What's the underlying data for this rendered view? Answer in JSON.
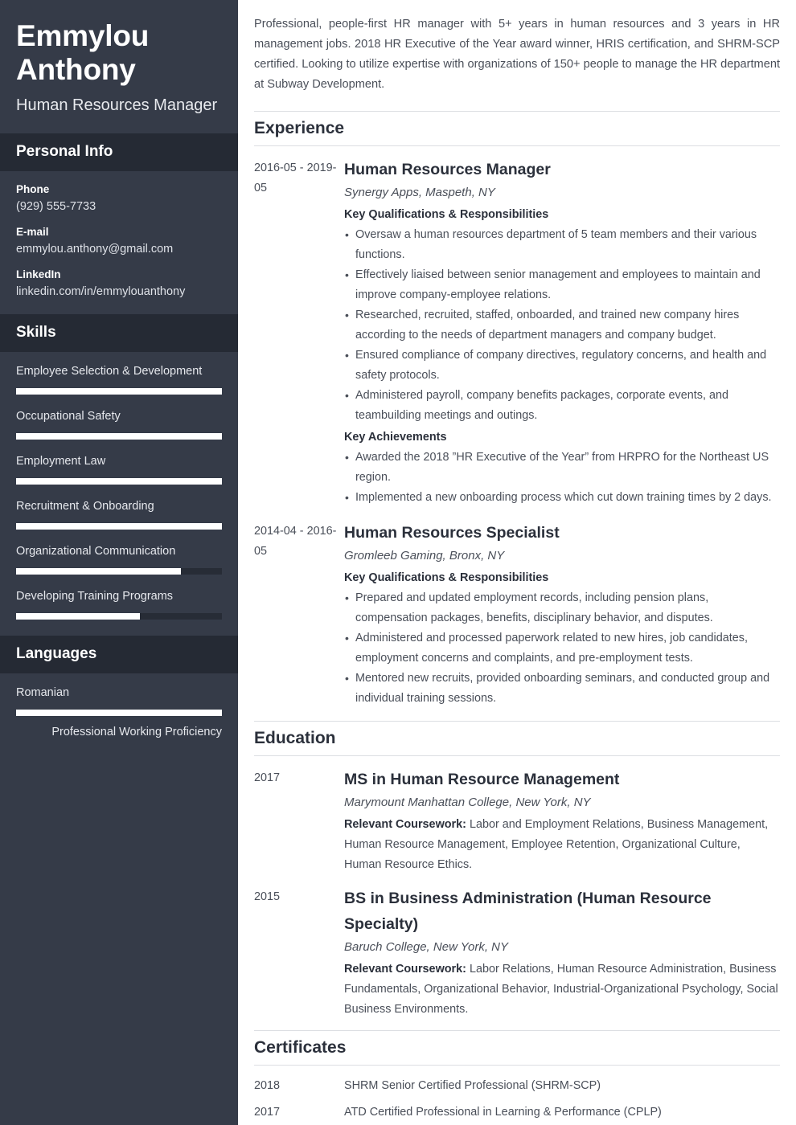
{
  "sidebar": {
    "name": "Emmylou Anthony",
    "job_title": "Human Resources Manager",
    "personal_info": {
      "heading": "Personal Info",
      "items": [
        {
          "label": "Phone",
          "value": "(929) 555-7733"
        },
        {
          "label": "E-mail",
          "value": "emmylou.anthony@gmail.com"
        },
        {
          "label": "LinkedIn",
          "value": "linkedin.com/in/emmylouanthony"
        }
      ]
    },
    "skills": {
      "heading": "Skills",
      "items": [
        {
          "name": "Employee Selection & Development",
          "level": 100
        },
        {
          "name": "Occupational Safety",
          "level": 100
        },
        {
          "name": "Employment Law",
          "level": 100
        },
        {
          "name": "Recruitment & Onboarding",
          "level": 100
        },
        {
          "name": "Organizational Communication",
          "level": 80
        },
        {
          "name": "Developing Training Programs",
          "level": 60
        }
      ]
    },
    "languages": {
      "heading": "Languages",
      "items": [
        {
          "name": "Romanian",
          "level": 100,
          "proficiency": "Professional Working Proficiency"
        }
      ]
    }
  },
  "main": {
    "summary": "Professional, people-first HR manager with 5+ years in human resources and 3 years in HR management jobs. 2018 HR Executive of the Year award winner, HRIS certification, and SHRM-SCP certified. Looking to utilize expertise with organizations of 150+ people to manage the HR department at Subway Development.",
    "experience": {
      "heading": "Experience",
      "entries": [
        {
          "date": "2016-05 - 2019-05",
          "role": "Human Resources Manager",
          "org": "Synergy Apps, Maspeth, NY",
          "qualifications_label": "Key Qualifications & Responsibilities",
          "qualifications": [
            "Oversaw a human resources department of 5 team members and their various functions.",
            "Effectively liaised between senior management and employees to maintain and improve company-employee relations.",
            "Researched, recruited, staffed, onboarded, and trained new company hires according to the needs of department managers and company budget.",
            "Ensured compliance of company directives, regulatory concerns, and health and safety protocols.",
            "Administered payroll, company benefits packages, corporate events, and teambuilding meetings and outings."
          ],
          "achievements_label": "Key Achievements",
          "achievements": [
            "Awarded the 2018 ”HR Executive of the Year” from HRPRO for the Northeast US region.",
            "Implemented a new onboarding process which cut down training times by 2 days."
          ]
        },
        {
          "date": "2014-04 - 2016-05",
          "role": "Human Resources Specialist",
          "org": "Gromleeb Gaming, Bronx, NY",
          "qualifications_label": "Key Qualifications & Responsibilities",
          "qualifications": [
            "Prepared and updated employment records, including pension plans, compensation packages, benefits, disciplinary behavior, and disputes.",
            "Administered and processed paperwork related to new hires, job candidates, employment concerns and complaints, and pre-employment tests.",
            "Mentored new recruits, provided onboarding seminars, and conducted group and individual training sessions."
          ],
          "achievements_label": "",
          "achievements": []
        }
      ]
    },
    "education": {
      "heading": "Education",
      "entries": [
        {
          "date": "2017",
          "degree": "MS in Human Resource Management",
          "school": "Marymount Manhattan College, New York, NY",
          "coursework_label": "Relevant Coursework:",
          "coursework": "Labor and Employment Relations, Business Management, Human Resource Management, Employee Retention, Organizational Culture, Human Resource Ethics."
        },
        {
          "date": "2015",
          "degree": "BS in Business Administration (Human Resource Specialty)",
          "school": "Baruch College, New York, NY",
          "coursework_label": "Relevant Coursework:",
          "coursework": "Labor Relations, Human Resource Administration, Business Fundamentals, Organizational Behavior, Industrial-Organizational Psychology, Social Business Environments."
        }
      ]
    },
    "certificates": {
      "heading": "Certificates",
      "entries": [
        {
          "date": "2018",
          "title": "SHRM Senior Certified Professional (SHRM-SCP)"
        },
        {
          "date": "2017",
          "title": "ATD Certified Professional in Learning & Performance (CPLP)"
        }
      ]
    }
  },
  "theme": {
    "sidebar_bg": "#353b48",
    "sidebar_band_bg": "#252a34",
    "bar_fill": "#ffffff",
    "bar_track": "#272c36",
    "heading_color": "#2b303b",
    "text_color": "#4a4f59"
  }
}
